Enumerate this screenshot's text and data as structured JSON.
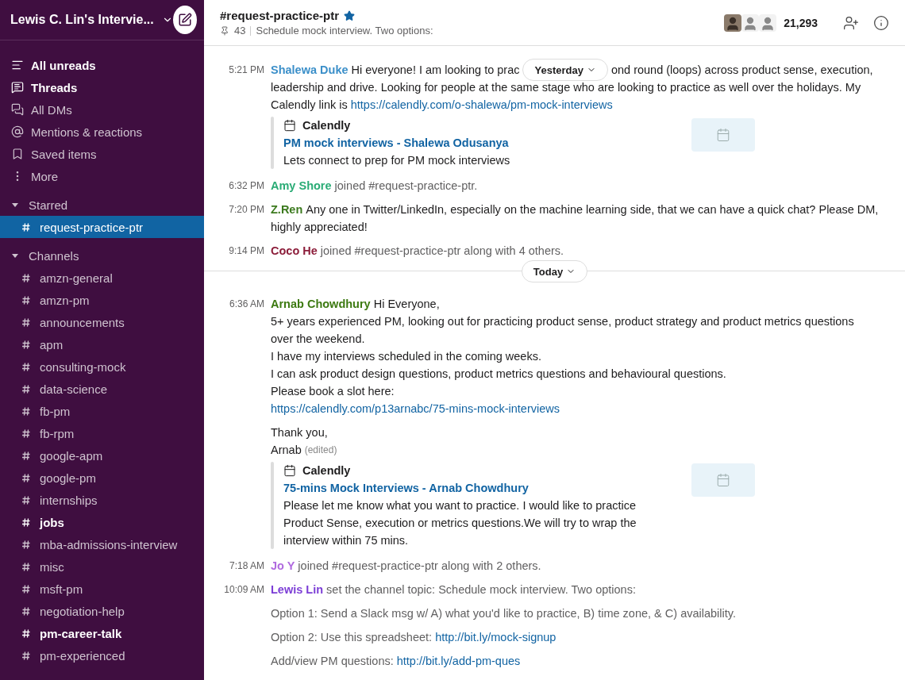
{
  "sidebar": {
    "workspace": "Lewis C. Lin's Intervie...",
    "nav": [
      {
        "kind": "unreads",
        "label": "All unreads",
        "unread": true
      },
      {
        "kind": "threads",
        "label": "Threads",
        "unread": true
      },
      {
        "kind": "dms",
        "label": "All DMs",
        "unread": false
      },
      {
        "kind": "mentions",
        "label": "Mentions & reactions",
        "unread": false
      },
      {
        "kind": "saved",
        "label": "Saved items",
        "unread": false
      },
      {
        "kind": "more",
        "label": "More",
        "unread": false
      }
    ],
    "sections": [
      {
        "title": "Starred",
        "expanded": true,
        "channels": [
          {
            "name": "request-practice-ptr",
            "selected": true,
            "unread": false
          }
        ]
      },
      {
        "title": "Channels",
        "expanded": true,
        "channels": [
          {
            "name": "amzn-general",
            "selected": false,
            "unread": false
          },
          {
            "name": "amzn-pm",
            "selected": false,
            "unread": false
          },
          {
            "name": "announcements",
            "selected": false,
            "unread": false
          },
          {
            "name": "apm",
            "selected": false,
            "unread": false
          },
          {
            "name": "consulting-mock",
            "selected": false,
            "unread": false
          },
          {
            "name": "data-science",
            "selected": false,
            "unread": false
          },
          {
            "name": "fb-pm",
            "selected": false,
            "unread": false
          },
          {
            "name": "fb-rpm",
            "selected": false,
            "unread": false
          },
          {
            "name": "google-apm",
            "selected": false,
            "unread": false
          },
          {
            "name": "google-pm",
            "selected": false,
            "unread": false
          },
          {
            "name": "internships",
            "selected": false,
            "unread": false
          },
          {
            "name": "jobs",
            "selected": false,
            "unread": true
          },
          {
            "name": "mba-admissions-interview",
            "selected": false,
            "unread": false
          },
          {
            "name": "misc",
            "selected": false,
            "unread": false
          },
          {
            "name": "msft-pm",
            "selected": false,
            "unread": false
          },
          {
            "name": "negotiation-help",
            "selected": false,
            "unread": false
          },
          {
            "name": "pm-career-talk",
            "selected": false,
            "unread": true
          },
          {
            "name": "pm-experienced",
            "selected": false,
            "unread": false
          }
        ]
      }
    ]
  },
  "channel_header": {
    "title": "#request-practice-ptr",
    "starred": true,
    "pins": "43",
    "topic": "Schedule mock interview. Two options:",
    "member_count": "21,293"
  },
  "feed": [
    {
      "kind": "message",
      "time": "5:21 PM",
      "author": "Shalewa Duke",
      "color": "#3b8fc9",
      "paragraphs": [
        [
          {
            "kind": "text",
            "text": "Hi everyone! I am looking to prac"
          },
          {
            "kind": "day_pill",
            "text": "Yesterday"
          },
          {
            "kind": "text",
            "text": "ond round (loops) across product sense, execution,"
          }
        ],
        [
          {
            "kind": "text",
            "text": "leadership and drive. Looking for people at the same stage who are looking to practice as well over the holidays. My"
          }
        ],
        [
          {
            "kind": "text",
            "text": "Calendly link is"
          },
          {
            "kind": "link",
            "text": "https://calendly.com/o-shalewa/pm-mock-interviews"
          }
        ]
      ],
      "attachment": {
        "service": "Calendly",
        "title": "PM mock interviews - Shalewa Odusanya",
        "description": "Lets connect to prep for PM mock interviews"
      }
    },
    {
      "kind": "join",
      "time": "6:32 PM",
      "author": "Amy Shore",
      "color": "#2bac76",
      "text": "joined #request-practice-ptr."
    },
    {
      "kind": "message",
      "time": "7:20 PM",
      "author": "Z.Ren",
      "color": "#3c7a1e",
      "paragraphs": [
        [
          {
            "kind": "text",
            "text": "Any one in Twitter/LinkedIn, especially on the machine learning side, that we can have a quick chat? Please DM,"
          }
        ],
        [
          {
            "kind": "text",
            "text": "highly appreciated!"
          }
        ]
      ]
    },
    {
      "kind": "join",
      "time": "9:14 PM",
      "author": "Coco He",
      "color": "#8c1d3a",
      "text": "joined #request-practice-ptr along with 4 others."
    },
    {
      "kind": "divider",
      "label": "Today"
    },
    {
      "kind": "message",
      "time": "6:36 AM",
      "author": "Arnab Chowdhury",
      "color": "#3d7a12",
      "paragraphs": [
        [
          {
            "kind": "text",
            "text": "Hi Everyone,"
          }
        ],
        [
          {
            "kind": "text",
            "text": "5+ years experienced PM, looking out for practicing product sense, product strategy and product metrics questions"
          }
        ],
        [
          {
            "kind": "text",
            "text": "over the weekend."
          }
        ],
        [
          {
            "kind": "text",
            "text": "I have my interviews scheduled in the coming weeks."
          }
        ],
        [
          {
            "kind": "text",
            "text": "I can ask product design questions, product metrics questions and behavioural questions."
          }
        ],
        [
          {
            "kind": "text",
            "text": "Please book a slot here:"
          }
        ],
        [
          {
            "kind": "link",
            "text": "https://calendly.com/p13arnabc/75-mins-mock-interviews"
          }
        ],
        [
          {
            "kind": "spacer"
          }
        ],
        [
          {
            "kind": "text",
            "text": "Thank you,"
          }
        ],
        [
          {
            "kind": "text",
            "text": "Arnab"
          },
          {
            "kind": "edited",
            "text": "(edited)"
          }
        ]
      ],
      "attachment": {
        "service": "Calendly",
        "title": "75-mins Mock Interviews - Arnab Chowdhury",
        "description": "Please let me know what you want to practice. I would like to practice Product Sense, execution or metrics questions.We will try to wrap the interview within 75 mins."
      }
    },
    {
      "kind": "join",
      "time": "7:18 AM",
      "author": "Jo Y",
      "color": "#b06bdf",
      "text": "joined #request-practice-ptr along with 2 others."
    },
    {
      "kind": "topic",
      "time": "10:09 AM",
      "author": "Lewis Lin",
      "color": "#7c3ed6",
      "text": "set the channel topic: Schedule mock interview. Two options:",
      "lines": [
        [
          {
            "kind": "text",
            "text": "Option 1: Send a Slack msg w/ A) what you'd like to practice, B) time zone, & C) availability."
          }
        ],
        [
          {
            "kind": "text",
            "text": "Option 2: Use this spreadsheet:"
          },
          {
            "kind": "link",
            "text": "http://bit.ly/mock-signup"
          }
        ],
        [
          {
            "kind": "text",
            "text": "Add/view PM questions:"
          },
          {
            "kind": "link",
            "text": "http://bit.ly/add-pm-ques"
          }
        ]
      ]
    }
  ]
}
